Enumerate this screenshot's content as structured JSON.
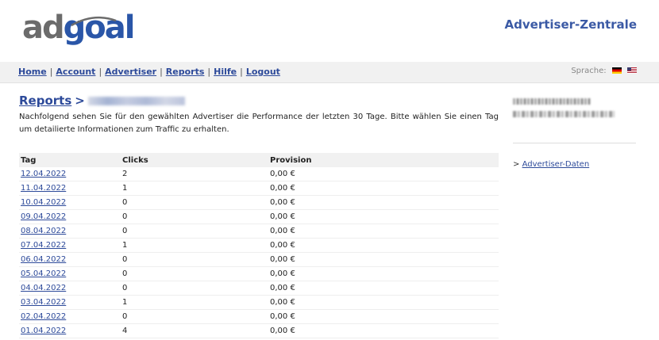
{
  "header": {
    "logo_text": "adgoal",
    "app_title": "Advertiser-Zentrale"
  },
  "nav": {
    "items": [
      "Home",
      "Account",
      "Advertiser",
      "Reports",
      "Hilfe",
      "Logout"
    ],
    "language_label": "Sprache:"
  },
  "main": {
    "breadcrumb_root": "Reports",
    "breadcrumb_sep": ">",
    "intro": "Nachfolgend sehen Sie für den gewählten Advertiser die Performance der letzten 30 Tage. Bitte wählen Sie einen Tag um detailierte Informationen zum Traffic zu erhalten."
  },
  "table": {
    "headers": [
      "Tag",
      "Clicks",
      "Provision"
    ],
    "rows": [
      {
        "date": "12.04.2022",
        "clicks": "2",
        "provision": "0,00 €"
      },
      {
        "date": "11.04.2022",
        "clicks": "1",
        "provision": "0,00 €"
      },
      {
        "date": "10.04.2022",
        "clicks": "0",
        "provision": "0,00 €"
      },
      {
        "date": "09.04.2022",
        "clicks": "0",
        "provision": "0,00 €"
      },
      {
        "date": "08.04.2022",
        "clicks": "0",
        "provision": "0,00 €"
      },
      {
        "date": "07.04.2022",
        "clicks": "1",
        "provision": "0,00 €"
      },
      {
        "date": "06.04.2022",
        "clicks": "0",
        "provision": "0,00 €"
      },
      {
        "date": "05.04.2022",
        "clicks": "0",
        "provision": "0,00 €"
      },
      {
        "date": "04.04.2022",
        "clicks": "0",
        "provision": "0,00 €"
      },
      {
        "date": "03.04.2022",
        "clicks": "1",
        "provision": "0,00 €"
      },
      {
        "date": "02.04.2022",
        "clicks": "0",
        "provision": "0,00 €"
      },
      {
        "date": "01.04.2022",
        "clicks": "4",
        "provision": "0,00 €"
      }
    ]
  },
  "sidebar": {
    "link_prefix": ">",
    "link_label": "Advertiser-Daten"
  },
  "colors": {
    "link": "#2d4a9a",
    "title": "#3b5aa5",
    "navbar_bg": "#f1f1f1"
  }
}
